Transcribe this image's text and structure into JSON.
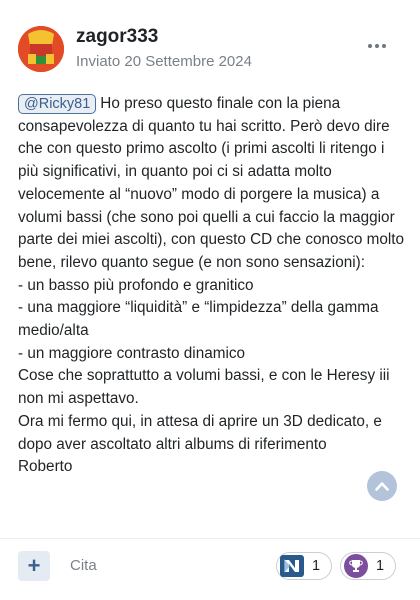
{
  "post": {
    "author": "zagor333",
    "posted": "Inviato 20 Settembre 2024",
    "mention": "@Ricky81",
    "first_line_text": "Ho preso questo finale con la piena consapevolezza di quanto tu hai scritto. Però devo dire che con questo primo ascolto (i primi ascolti li ritengo i più significativi, in quanto poi ci si adatta molto velocemente al “nuovo” modo di porgere la musica) a volumi bassi (che sono poi quelli a cui faccio la maggior parte dei miei ascolti), con questo CD che conosco molto bene, rilevo quanto segue (e non sono sensazioni):",
    "lines": [
      "- un basso più profondo e granitico",
      "- una maggiore “liquidità” e “limpidezza” della gamma medio/alta",
      "- un maggiore contrasto dinamico",
      "Cose che soprattutto a volumi bassi, e con le Heresy iii non mi aspettavo.",
      "Ora mi fermo qui, in attesa di aprire un 3D dedicato, e dopo aver ascoltato altri  albums di riferimento",
      "Roberto"
    ]
  },
  "footer": {
    "add_label": "+",
    "quote_label": "Cita",
    "reactions": [
      {
        "icon": "n-reaction-icon",
        "count": "1"
      },
      {
        "icon": "trophy-icon",
        "count": "1"
      }
    ]
  },
  "colors": {
    "mention_bg": "#e9eef4",
    "mention_border": "#4c6f9b",
    "scroll_button": "#b3c3d9",
    "reaction_blue": "#2a5a8c",
    "reaction_purple": "#7b4f9e"
  }
}
